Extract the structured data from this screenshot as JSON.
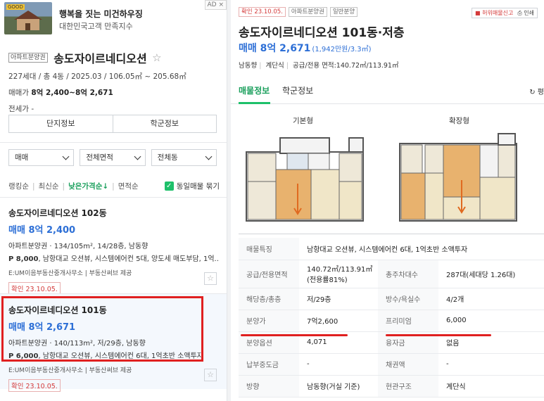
{
  "ad": {
    "badge": "GOOD",
    "title": "행복을 짓는 미건하우징",
    "subtitle": "대한민국고객 만족지수",
    "tag": "AD ×"
  },
  "complex": {
    "type_tag": "아파트분양권",
    "name": "송도자이르네디오션",
    "star": "☆",
    "meta": "227세대 / 총 4동 / 2025.03 / 106.05㎡ ~ 205.68㎡",
    "sale_label": "매매가",
    "sale_range": "8억 2,400~8억 2,671",
    "jeonse": "전세가 -",
    "buttons": [
      "단지정보",
      "학군정보"
    ]
  },
  "filters": [
    "매매",
    "전체면적",
    "전체동"
  ],
  "sort": {
    "options": [
      "랭킹순",
      "최신순",
      "낮은가격순↓",
      "면적순"
    ],
    "active_index": 2,
    "same_listing": "동일매물 묶기",
    "same_checked": true
  },
  "listings": [
    {
      "title": "송도자이르네디오션 102동",
      "price": "매매 8억 2,400",
      "desc": "아파트분양권 · 134/105m², 14/28층, 남동향",
      "premium": "P 8,000",
      "desc2": ", 남항대교 오션뷰, 시스템에어컨 5대, 양도세 매도부담, 1억...",
      "agent": "E:UM이음부동산중개사무소 | 부동산써브 제공",
      "confirm": "확인 23.10.05."
    },
    {
      "title": "송도자이르네디오션 101동",
      "price": "매매 8억 2,671",
      "desc": "아파트분양권 · 140/113m², 저/29층, 남동향",
      "premium": "P 6,000",
      "desc2": ", 남항대교 오션뷰, 시스템에어컨 6대, 1억초반 소액투자",
      "agent": "E:UM이음부동산중개사무소 | 부동산써브 제공",
      "confirm": "확인 23.10.05."
    }
  ],
  "detail": {
    "tags": [
      "확인 23.10.05.",
      "아파트분양권",
      "일반분양"
    ],
    "report": "허위매물신고",
    "print": "인쇄",
    "title": "송도자이르네디오션 101동·저층",
    "price": "매매 8억 2,671",
    "price_per": "(1,942만원/3.3㎡)",
    "info": [
      "남동향",
      "계단식",
      "공급/전용 면적:140.72㎡/113.91㎡"
    ],
    "tabs": [
      "매물정보",
      "학군정보"
    ],
    "refresh": "↻ 평",
    "plans": [
      "기본형",
      "확장형"
    ],
    "rows": [
      {
        "k1": "매물특징",
        "v1": "남항대교 오션뷰, 시스템에어컨 6대, 1억초반 소액투자",
        "full": true
      },
      {
        "k1": "공급/전용면적",
        "v1": "140.72㎡/113.91㎡(전용률81%)",
        "k2": "총주차대수",
        "v2": "287대(세대당 1.26대)"
      },
      {
        "k1": "해당층/총층",
        "v1": "저/29층",
        "k2": "방수/욕실수",
        "v2": "4/2개"
      },
      {
        "k1": "분양가",
        "v1": "7억2,600",
        "k2": "프리미엄",
        "v2": "6,000"
      },
      {
        "k1": "분양옵션",
        "v1": "4,071",
        "k2": "융자금",
        "v2": "없음"
      },
      {
        "k1": "납부중도금",
        "v1": "-",
        "k2": "채권액",
        "v2": "-"
      },
      {
        "k1": "방향",
        "v1": "남동향(거실 기준)",
        "k2": "현관구조",
        "v2": "계단식"
      }
    ]
  },
  "colors": {
    "accent_green": "#1ec06a",
    "price_blue": "#2d6fd6",
    "highlight_red": "#e02020"
  }
}
